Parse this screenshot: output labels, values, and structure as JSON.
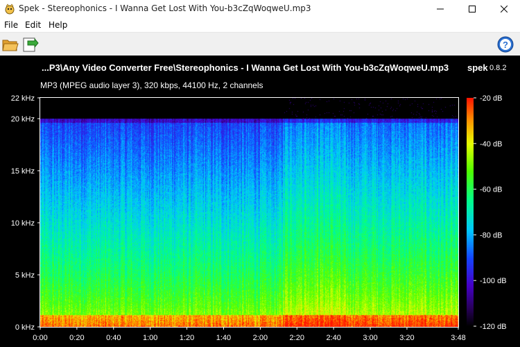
{
  "window": {
    "title": "Spek - Stereophonics - I Wanna Get Lost With You-b3cZqWoqweU.mp3"
  },
  "menu": {
    "items": [
      "File",
      "Edit",
      "Help"
    ]
  },
  "toolbar": {
    "open_icon": "folder-open-icon",
    "save_icon": "save-export-icon",
    "help_icon": "help-icon"
  },
  "header": {
    "file_path": "...P3\\Any Video Converter Free\\Stereophonics - I Wanna Get Lost With You-b3cZqWoqweU.mp3",
    "app_name": "spek",
    "app_version": "0.8.2",
    "file_info": "MP3 (MPEG audio layer 3), 320 kbps, 44100 Hz, 2 channels"
  },
  "chart_data": {
    "type": "heatmap",
    "xlabel": "",
    "ylabel": "",
    "x_ticks": [
      "0:00",
      "0:20",
      "0:40",
      "1:00",
      "1:20",
      "1:40",
      "2:00",
      "2:20",
      "2:40",
      "3:00",
      "3:20",
      "3:48"
    ],
    "y_ticks": [
      "0 kHz",
      "5 kHz",
      "10 kHz",
      "15 kHz",
      "20 kHz",
      "22 kHz"
    ],
    "colorbar_ticks": [
      "-20 dB",
      "-40 dB",
      "-60 dB",
      "-80 dB",
      "-100 dB",
      "-120 dB"
    ],
    "x_range_seconds": [
      0,
      228
    ],
    "y_range_khz": [
      0,
      22
    ],
    "colorbar_range_db": [
      -120,
      -20
    ],
    "cutoff_khz": 20
  }
}
